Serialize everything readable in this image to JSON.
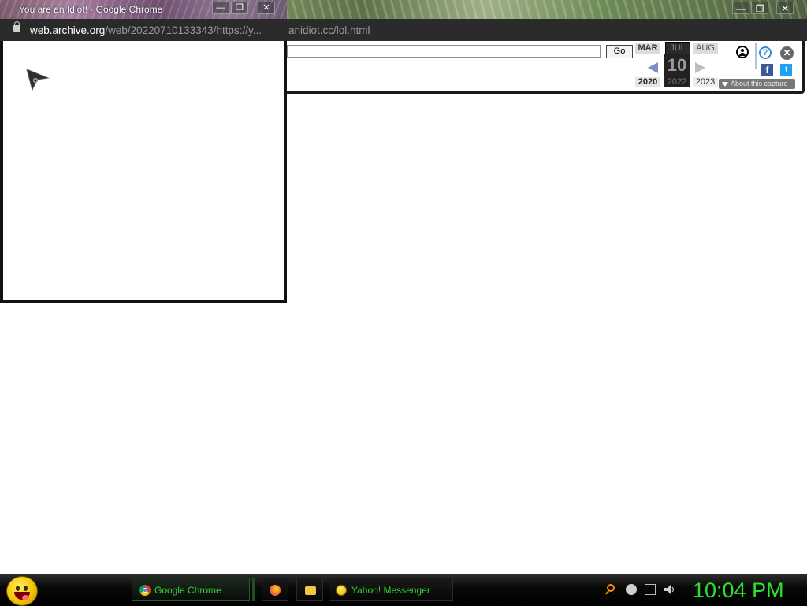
{
  "main_window": {
    "url_visible": "anidiot.cc/lol.html",
    "controls": {
      "minimize": "—",
      "restore": "❐",
      "close": "✕"
    }
  },
  "wayback": {
    "go_label": "Go",
    "months": {
      "prev": "MAR",
      "current": "JUL",
      "next": "AUG"
    },
    "day": "10",
    "years": {
      "prev": "2020",
      "current": "2022",
      "next": "2023"
    },
    "help_label": "?",
    "close_label": "✕",
    "facebook_label": "f",
    "twitter_label": "t",
    "about_label": "About this capture"
  },
  "popup": {
    "title": "You are an Idiot! - Google Chrome",
    "url_host": "web.archive.org",
    "url_path": "/web/20220710133343/https://y...",
    "controls": {
      "minimize": "—",
      "restore": "❐",
      "close": "✕"
    }
  },
  "taskbar": {
    "items": [
      {
        "label": "Google Chrome",
        "icon": "chrome-icon"
      },
      {
        "label": "",
        "icon": "firefox-icon"
      },
      {
        "label": "",
        "icon": "folder-icon"
      },
      {
        "label": "Yahoo! Messenger",
        "icon": "yahoo-messenger-icon"
      }
    ],
    "clock": "10:04 PM",
    "accent_color": "#2ed62e"
  }
}
